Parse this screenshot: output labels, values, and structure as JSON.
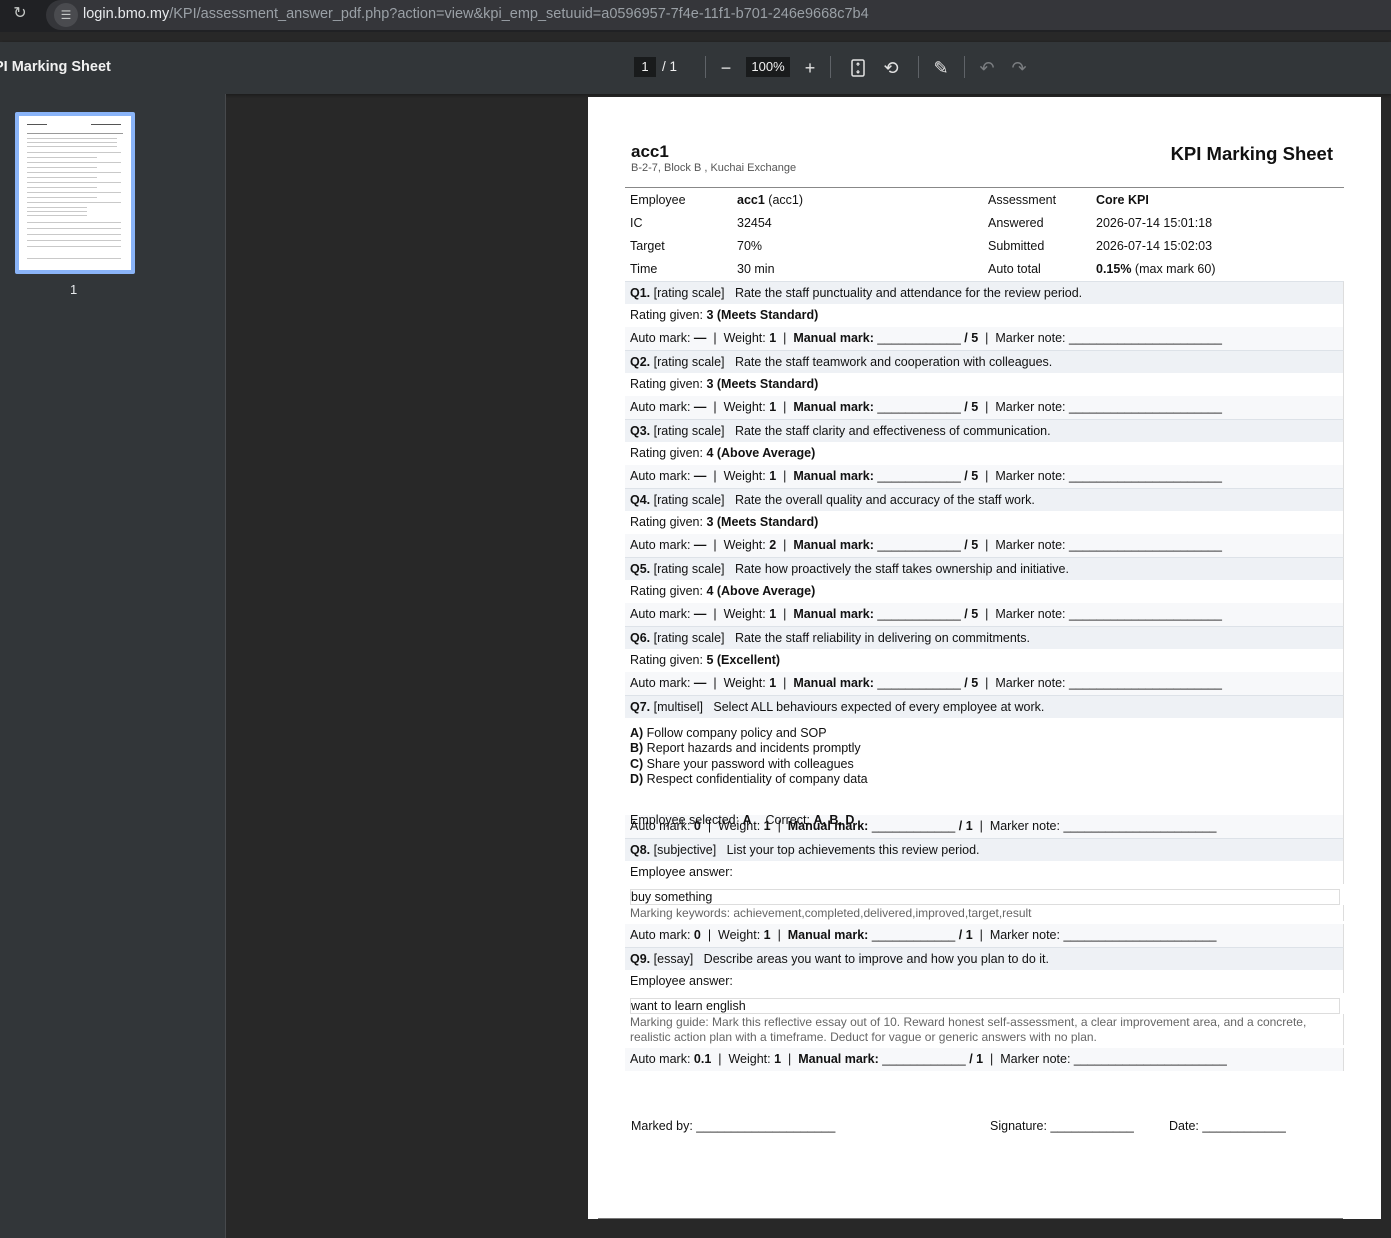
{
  "browser": {
    "url_host": "login.bmo.my",
    "url_path": "/KPI/assessment_answer_pdf.php?action=view&kpi_emp_setuuid=a0596957-7f4e-11f1-b701-246e9668c7b4"
  },
  "viewer": {
    "title": "PI Marking Sheet",
    "current_page": "1",
    "total_pages": "/  1",
    "zoom": "100%",
    "thumbnail_label": "1",
    "icons": [
      "reload-icon",
      "site-info-icon",
      "zoom-out-icon",
      "zoom-in-icon",
      "fit-page-icon",
      "rotate-icon",
      "annotate-icon",
      "undo-icon",
      "redo-icon"
    ]
  },
  "doc": {
    "company": "acc1",
    "address": "B-2-7, Block B , Kuchai Exchange",
    "title": "KPI Marking Sheet",
    "info": [
      {
        "l1": "Employee",
        "v1b": "acc1",
        "v1": " (acc1)",
        "l2": "Assessment",
        "v2b": "Core KPI",
        "v2": ""
      },
      {
        "l1": "IC",
        "v1b": "",
        "v1": "32454",
        "l2": "Answered",
        "v2b": "",
        "v2": "2026-07-14 15:01:18"
      },
      {
        "l1": "Target",
        "v1b": "",
        "v1": "70%",
        "l2": "Submitted",
        "v2b": "",
        "v2": "2026-07-14 15:02:03"
      },
      {
        "l1": "Time",
        "v1b": "",
        "v1": "30 min",
        "l2": "Auto total",
        "v2b": "0.15%",
        "v2": " (max mark 60)"
      }
    ],
    "questions": [
      {
        "no": "Q1.",
        "type": "[rating scale]",
        "text": "Rate the staff punctuality and attendance for the review period.",
        "rating_label": "Rating given: ",
        "rating": "3 (Meets Standard)",
        "auto": "—",
        "weight": "1",
        "max": "/ 5"
      },
      {
        "no": "Q2.",
        "type": "[rating scale]",
        "text": "Rate the staff teamwork and cooperation with colleagues.",
        "rating_label": "Rating given: ",
        "rating": "3 (Meets Standard)",
        "auto": "—",
        "weight": "1",
        "max": "/ 5"
      },
      {
        "no": "Q3.",
        "type": "[rating scale]",
        "text": "Rate the staff clarity and effectiveness of communication.",
        "rating_label": "Rating given: ",
        "rating": "4 (Above Average)",
        "auto": "—",
        "weight": "1",
        "max": "/ 5"
      },
      {
        "no": "Q4.",
        "type": "[rating scale]",
        "text": "Rate the overall quality and accuracy of the staff work.",
        "rating_label": "Rating given: ",
        "rating": "3 (Meets Standard)",
        "auto": "—",
        "weight": "2",
        "max": "/ 5"
      },
      {
        "no": "Q5.",
        "type": "[rating scale]",
        "text": "Rate how proactively the staff takes ownership and initiative.",
        "rating_label": "Rating given: ",
        "rating": "4 (Above Average)",
        "auto": "—",
        "weight": "1",
        "max": "/ 5"
      },
      {
        "no": "Q6.",
        "type": "[rating scale]",
        "text": "Rate the staff reliability in delivering on commitments.",
        "rating_label": "Rating given: ",
        "rating": "5 (Excellent)",
        "auto": "—",
        "weight": "1",
        "max": "/ 5"
      }
    ],
    "q7": {
      "no": "Q7.",
      "type": "[multisel]",
      "text": "Select ALL behaviours expected of every employee at work.",
      "options": [
        {
          "key": "A)",
          "text": " Follow company policy and SOP"
        },
        {
          "key": "B)",
          "text": " Report hazards and incidents promptly"
        },
        {
          "key": "C)",
          "text": " Share your password with colleagues"
        },
        {
          "key": "D)",
          "text": " Respect confidentiality of company data"
        }
      ],
      "selected_label": "Employee selected: ",
      "selected": "A",
      "correct_label": "Correct: ",
      "correct": "A, B, D",
      "auto": "0",
      "weight": "1",
      "max": "/ 1"
    },
    "q8": {
      "no": "Q8.",
      "type": "[subjective]",
      "text": "List your top achievements this review period.",
      "answer_label": "Employee answer:",
      "answer": "buy something",
      "guide": "Marking keywords: achievement,completed,delivered,improved,target,result",
      "auto": "0",
      "weight": "1",
      "max": "/ 1"
    },
    "q9": {
      "no": "Q9.",
      "type": "[essay]",
      "text": "Describe areas you want to improve and how you plan to do it.",
      "answer_label": "Employee answer:",
      "answer": "want to learn english",
      "guide": "Marking guide: Mark this reflective essay out of 10. Reward honest self-assessment, a clear improvement area, and a concrete, realistic action plan with a timeframe. Deduct for vague or generic answers with no plan.",
      "auto": "0.1",
      "weight": "1",
      "max": "/ 1"
    },
    "labels": {
      "auto": "Auto mark: ",
      "weight": "Weight: ",
      "manual": "Manual mark: ",
      "manual_blank": "____________",
      "note": "Marker note: ",
      "note_blank": "______________________",
      "sep": "|"
    },
    "footer": {
      "marked_by": "Marked by: ____________________",
      "signature": "Signature: ____________",
      "date": "Date: ____________"
    }
  }
}
